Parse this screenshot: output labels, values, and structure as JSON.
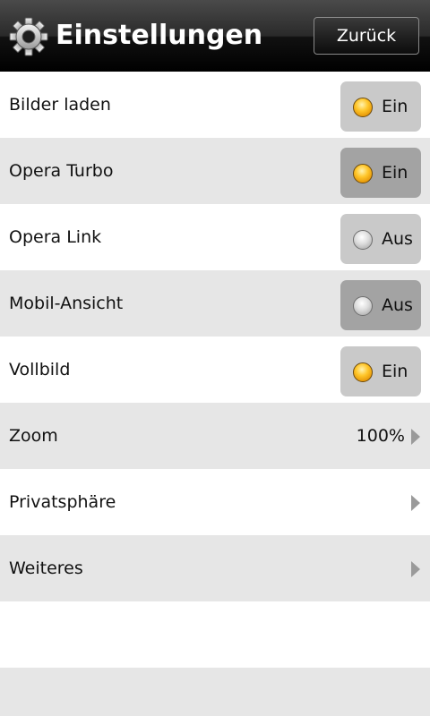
{
  "header": {
    "title": "Einstellungen",
    "back_label": "Zurück",
    "icon": "gear-icon"
  },
  "settings": [
    {
      "label": "Bilder laden",
      "state": "Ein",
      "on": true
    },
    {
      "label": "Opera Turbo",
      "state": "Ein",
      "on": true
    },
    {
      "label": "Opera Link",
      "state": "Aus",
      "on": false
    },
    {
      "label": "Mobil-Ansicht",
      "state": "Aus",
      "on": false
    },
    {
      "label": "Vollbild",
      "state": "Ein",
      "on": true
    }
  ],
  "nav_items": [
    {
      "label": "Zoom",
      "value": "100%"
    },
    {
      "label": "Privatsphäre",
      "value": ""
    },
    {
      "label": "Weiteres",
      "value": ""
    }
  ],
  "colors": {
    "led_on": "#ffc62a",
    "led_off": "#dcdcdc",
    "row_alt": "#e6e6e6"
  }
}
